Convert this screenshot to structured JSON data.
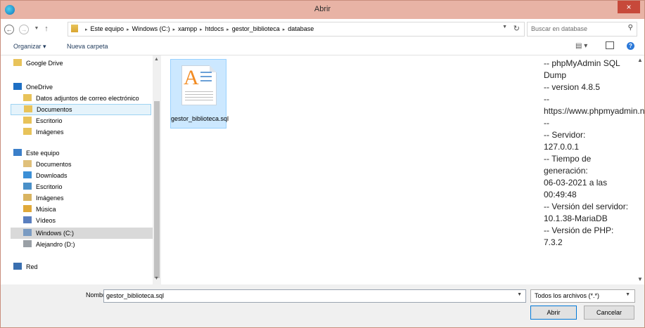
{
  "window": {
    "title": "Abrir",
    "close": "×"
  },
  "nav": {
    "back": "←",
    "forward": "→",
    "recent": "▼",
    "up": "↑",
    "breadcrumbs": [
      "Este equipo",
      "Windows (C:)",
      "xampp",
      "htdocs",
      "gestor_biblioteca",
      "database"
    ],
    "search_placeholder": "Buscar en database"
  },
  "toolbar": {
    "organize": "Organizar ▾",
    "new_folder": "Nueva carpeta"
  },
  "sidebar": {
    "items": [
      {
        "label": "Google Drive",
        "icon": "folder-icon",
        "level": 1
      },
      {
        "label": "OneDrive",
        "icon": "cloud-icon",
        "level": 1
      },
      {
        "label": "Datos adjuntos de correo electrónico",
        "icon": "folder-icon",
        "level": 2
      },
      {
        "label": "Documentos",
        "icon": "folder-icon",
        "level": 2,
        "selected": true
      },
      {
        "label": "Escritorio",
        "icon": "folder-icon",
        "level": 2
      },
      {
        "label": "Imágenes",
        "icon": "folder-icon",
        "level": 2
      },
      {
        "label": "Este equipo",
        "icon": "computer-icon",
        "level": 1
      },
      {
        "label": "Documentos",
        "icon": "documents-icon",
        "level": 2
      },
      {
        "label": "Downloads",
        "icon": "downloads-icon",
        "level": 2
      },
      {
        "label": "Escritorio",
        "icon": "desktop-icon",
        "level": 2
      },
      {
        "label": "Imágenes",
        "icon": "pictures-icon",
        "level": 2
      },
      {
        "label": "Música",
        "icon": "music-icon",
        "level": 2
      },
      {
        "label": "Vídeos",
        "icon": "videos-icon",
        "level": 2
      },
      {
        "label": "Windows (C:)",
        "icon": "drive-c-icon",
        "level": 2,
        "highlighted": true
      },
      {
        "label": "Alejandro (D:)",
        "icon": "drive-icon",
        "level": 2
      },
      {
        "label": "Red",
        "icon": "network-icon",
        "level": 1
      }
    ]
  },
  "files": [
    {
      "name": "gestor_biblioteca.sql",
      "icon": "sql-file-icon",
      "selected": true
    }
  ],
  "preview": {
    "text": "-- phpMyAdmin SQL Dump\n-- version 4.8.5\n--\nhttps://www.phpmyadmin.net/\n--\n-- Servidor:\n127.0.0.1\n-- Tiempo de generación:\n06-03-2021 a las 00:49:48\n-- Versión del servidor: 10.1.38-MariaDB\n-- Versión de PHP: 7.3.2"
  },
  "bottom": {
    "name_label": "Nombre:",
    "name_value": "gestor_biblioteca.sql",
    "file_type": "Todos los archivos (*.*)",
    "open": "Abrir",
    "cancel": "Cancelar"
  },
  "colors": {
    "titlebar": "#e8b3a5",
    "close": "#c7493a",
    "selection": "#cce8ff",
    "folder": "#e8c35a"
  }
}
